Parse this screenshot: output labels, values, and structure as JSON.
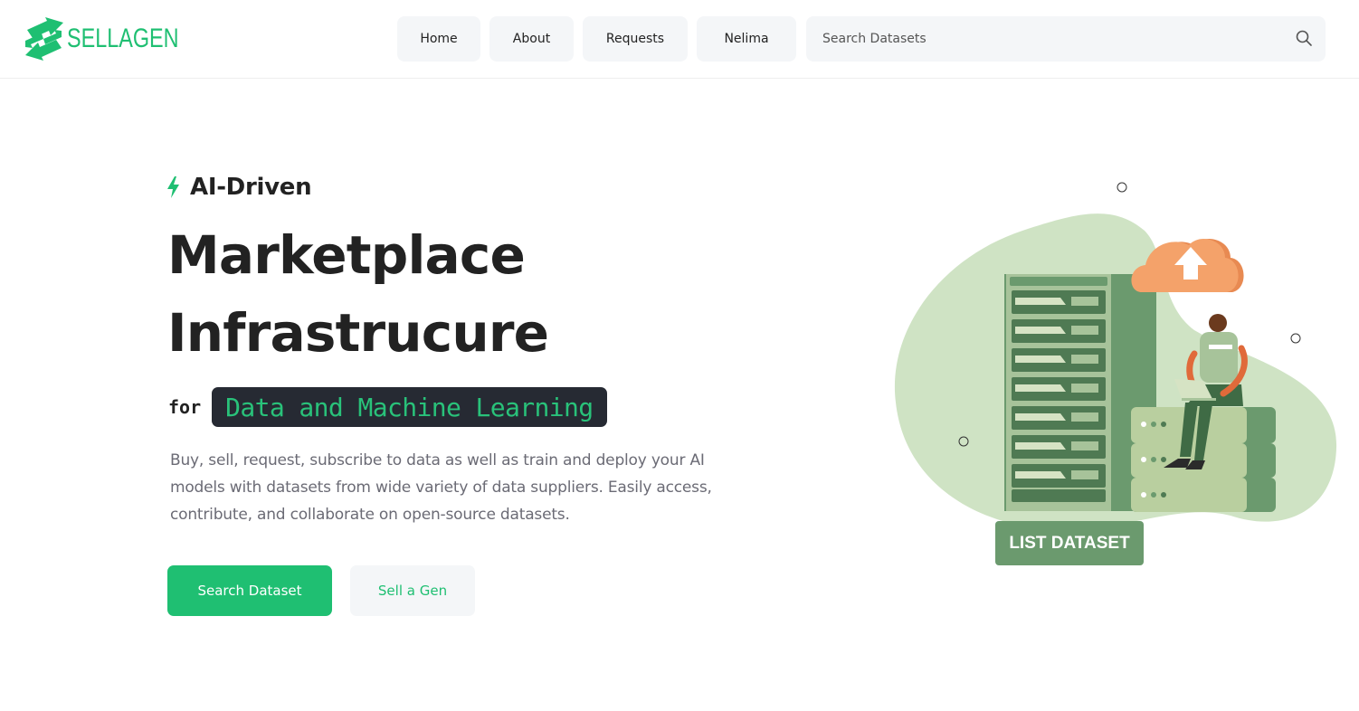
{
  "brand": {
    "name": "SELLAGEN",
    "accent": "#1fbf72",
    "dark": "#262a33"
  },
  "nav": {
    "items": [
      {
        "label": "Home"
      },
      {
        "label": "About"
      },
      {
        "label": "Requests"
      },
      {
        "label": "Nelima"
      }
    ],
    "search_placeholder": "Search Datasets",
    "search_icon": "search-icon"
  },
  "hero": {
    "tag_icon": "lightning-icon",
    "tag": "AI-Driven",
    "title_line1": "Marketplace",
    "title_line2": "Infrastrucure",
    "for_word": "for",
    "highlight": "Data and Machine Learning",
    "description": "Buy, sell, request, subscribe to data as well as train and deploy your AI models with datasets from wide variety of data suppliers. Easily access, contribute, and collaborate on open-source datasets.",
    "primary_cta": "Search Dataset",
    "secondary_cta": "Sell a Gen"
  },
  "illustration": {
    "button_label": "LIST DATASET",
    "colors": {
      "blob": "#cfe3c4",
      "server": "#6b9a6e",
      "cloud": "#f4a26a",
      "button": "#6b9a6e"
    }
  }
}
